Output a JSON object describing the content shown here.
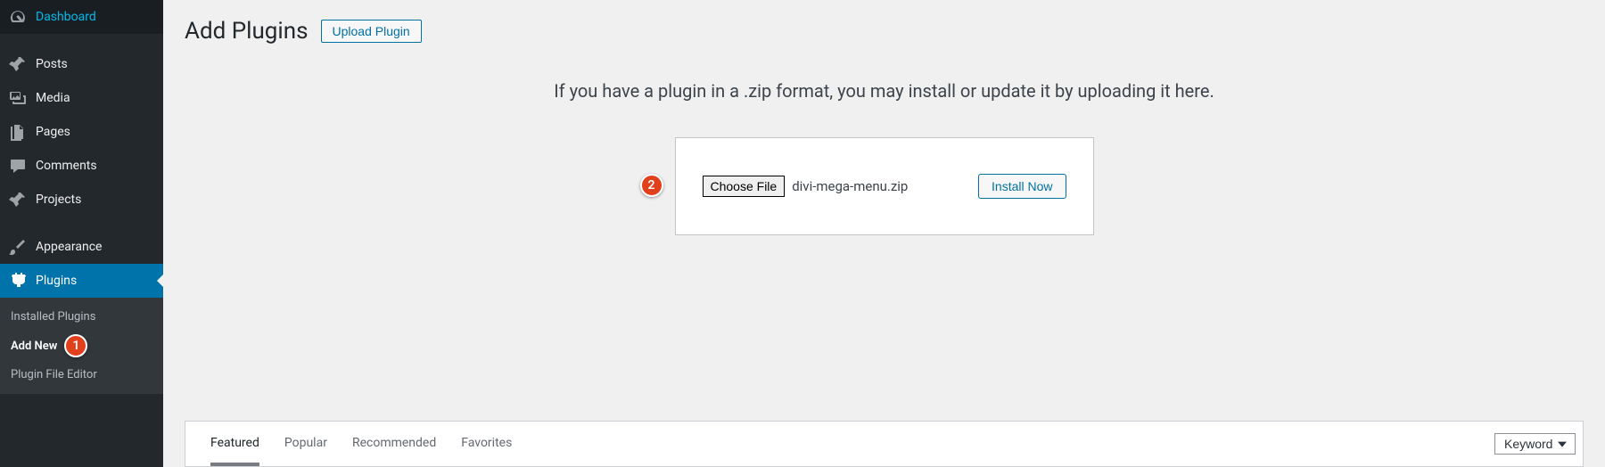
{
  "sidebar": {
    "items": [
      {
        "label": "Dashboard"
      },
      {
        "label": "Posts"
      },
      {
        "label": "Media"
      },
      {
        "label": "Pages"
      },
      {
        "label": "Comments"
      },
      {
        "label": "Projects"
      },
      {
        "label": "Appearance"
      },
      {
        "label": "Plugins"
      }
    ],
    "sub": {
      "installed": "Installed Plugins",
      "addnew": "Add New",
      "editor": "Plugin File Editor"
    }
  },
  "callouts": {
    "one": "1",
    "two": "2"
  },
  "header": {
    "title": "Add Plugins",
    "upload_btn": "Upload Plugin"
  },
  "upload": {
    "desc": "If you have a plugin in a .zip format, you may install or update it by uploading it here.",
    "choose_label": "Choose File",
    "file_name": "divi-mega-menu.zip",
    "install_label": "Install Now"
  },
  "filter": {
    "tabs": {
      "featured": "Featured",
      "popular": "Popular",
      "recommended": "Recommended",
      "favorites": "Favorites"
    },
    "keyword": "Keyword"
  }
}
